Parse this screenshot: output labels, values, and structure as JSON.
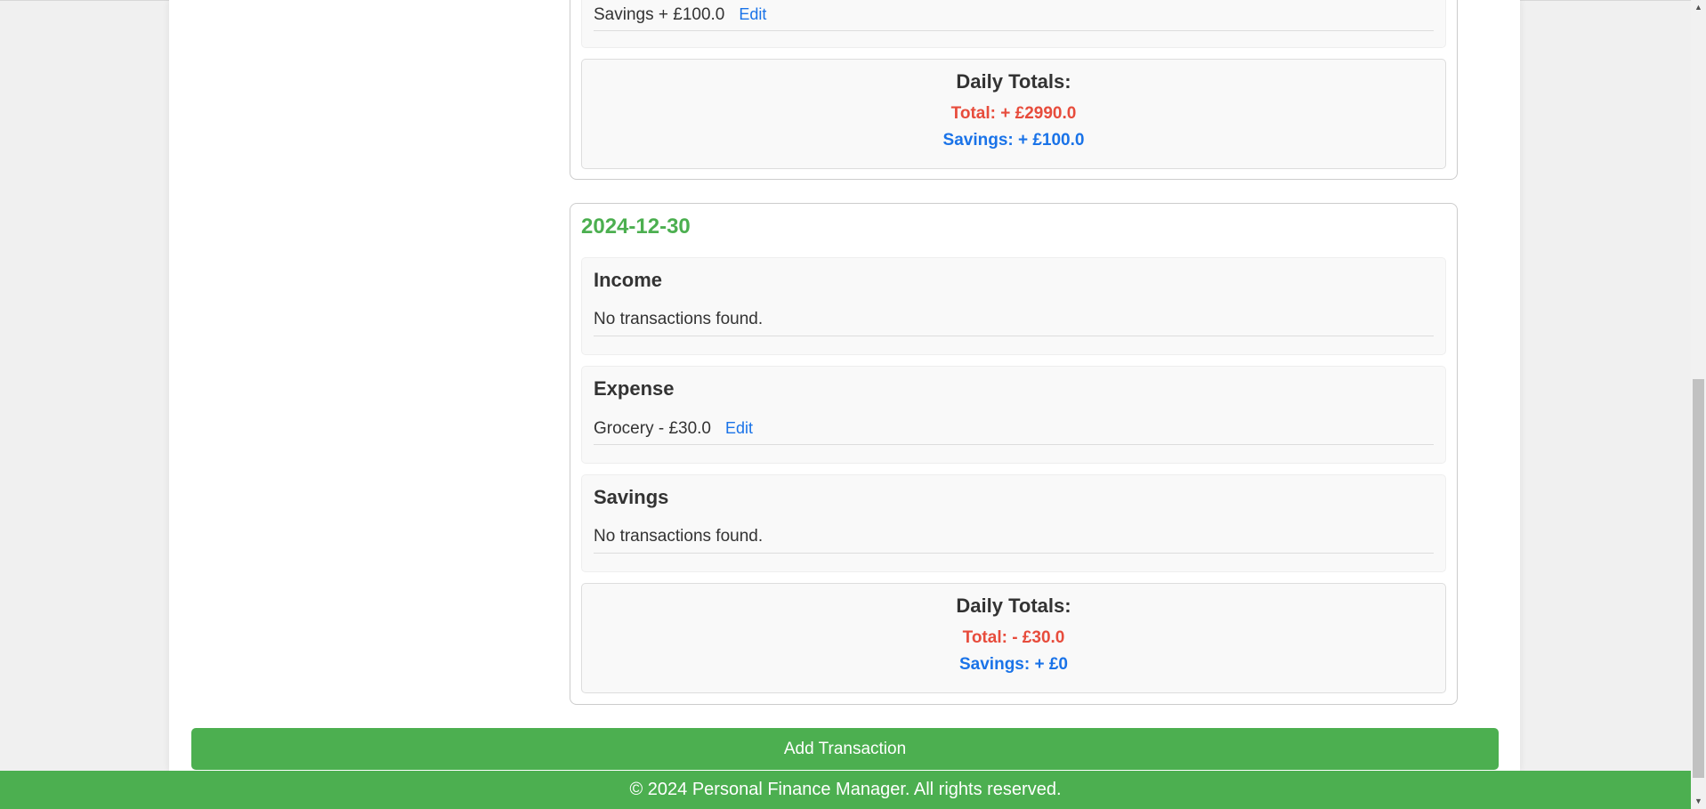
{
  "previous_day": {
    "savings_line": {
      "text": "Savings + £100.0",
      "edit_label": "Edit"
    },
    "totals": {
      "title": "Daily Totals:",
      "total": "Total: + £2990.0",
      "savings": "Savings: + £100.0"
    }
  },
  "current_day": {
    "date": "2024-12-30",
    "sections": [
      {
        "title": "Income",
        "line": "No transactions found.",
        "edit_label": ""
      },
      {
        "title": "Expense",
        "line": "Grocery - £30.0",
        "edit_label": "Edit"
      },
      {
        "title": "Savings",
        "line": "No transactions found.",
        "edit_label": ""
      }
    ],
    "totals": {
      "title": "Daily Totals:",
      "total": "Total: - £30.0",
      "savings": "Savings: + £0"
    }
  },
  "add_button_label": "Add Transaction",
  "footer_text": "© 2024 Personal Finance Manager. All rights reserved.",
  "scrollbar": {
    "up_arrow_glyph": "▲",
    "down_arrow_glyph": "▼"
  },
  "colors": {
    "accent_green": "#4caf50",
    "total_red": "#e74c3c",
    "savings_blue": "#1a73e8",
    "link_blue": "#1a73e8"
  }
}
